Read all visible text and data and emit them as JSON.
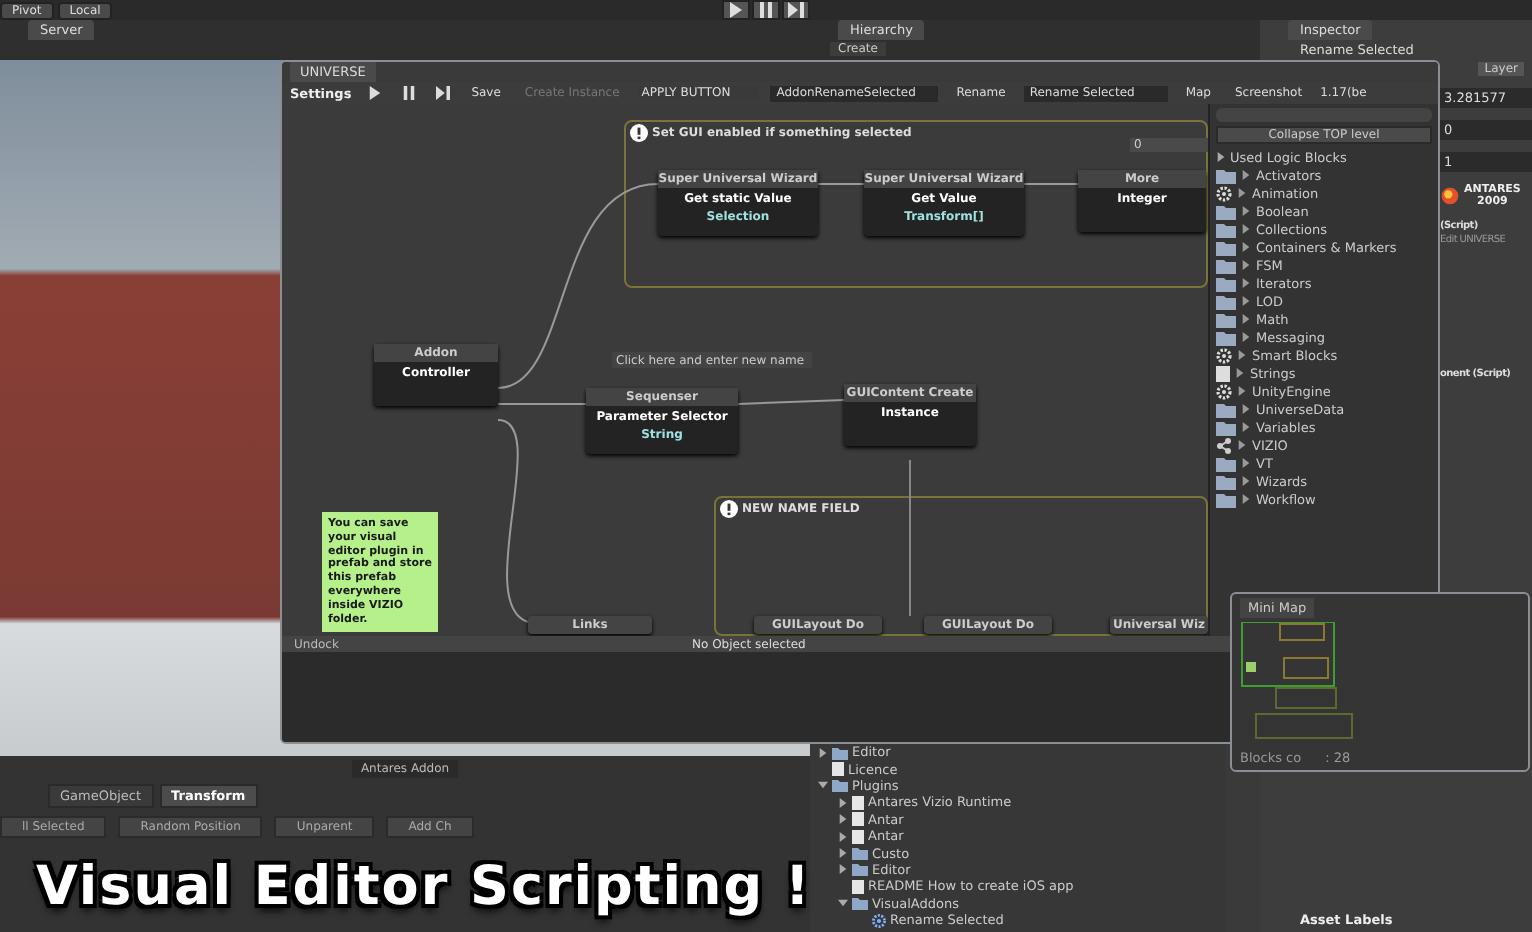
{
  "editor": {
    "pivot": "Pivot",
    "local": "Local"
  },
  "server_panel": {
    "tab": "Server"
  },
  "hierarchy_panel": {
    "tab": "Hierarchy",
    "create": "Create"
  },
  "inspector": {
    "tab": "Inspector",
    "object": "Rename Selected",
    "layer": "Layer",
    "fields": [
      "3.281577",
      "0",
      "1"
    ],
    "logo": {
      "name": "ANTARES",
      "year": "2009"
    },
    "sections": [
      "(Script)",
      "Edit UNIVERSE",
      "onent (Script)"
    ],
    "asset_labels": "Asset Labels"
  },
  "universe": {
    "tab": "UNIVERSE",
    "toolbar": [
      {
        "kind": "label",
        "text": "Settings",
        "disabled": false
      },
      {
        "kind": "play",
        "disabled": false
      },
      {
        "kind": "pause",
        "disabled": false
      },
      {
        "kind": "step",
        "disabled": false
      },
      {
        "kind": "button",
        "text": "Save",
        "disabled": false
      },
      {
        "kind": "button",
        "text": "Create Instance",
        "disabled": true
      },
      {
        "kind": "dropdown",
        "text": "APPLY BUTTON",
        "disabled": false
      },
      {
        "kind": "field",
        "text": "AddonRenameSelected",
        "disabled": false
      },
      {
        "kind": "button",
        "text": "Rename",
        "disabled": false
      },
      {
        "kind": "field",
        "text": "Rename Selected",
        "disabled": false
      },
      {
        "kind": "button",
        "text": "Map",
        "disabled": false
      },
      {
        "kind": "button",
        "text": "Screenshot",
        "disabled": false
      },
      {
        "kind": "version",
        "text": "1.17(be",
        "disabled": false
      }
    ],
    "groups": [
      {
        "title": "Set GUI enabled if something selected"
      },
      {
        "title": "NEW NAME FIELD"
      }
    ],
    "nodes": [
      {
        "title": "Super Universal Wizard",
        "action": "Get static Value",
        "type": "Selection"
      },
      {
        "title": "Super Universal Wizard",
        "action": "Get Value",
        "type": "Transform[]"
      },
      {
        "title": "More",
        "action": "Integer"
      },
      {
        "title": "Addon",
        "action": "Controller"
      },
      {
        "title": "Sequenser",
        "action": "Parameter Selector",
        "type": "String"
      },
      {
        "title": "GUIContent Create",
        "action": "Instance"
      },
      {
        "title": "Links"
      },
      {
        "title": "GUILayout Do"
      },
      {
        "title": "GUILayout Do"
      },
      {
        "title": "Universal Wiz"
      }
    ],
    "value_field": "0",
    "name_field": {
      "placeholder": "Click here and enter new name"
    },
    "note": "You can save your visual editor plugin in prefab and store this prefab everywhere inside VIZIO folder.",
    "library": {
      "collapse": "Collapse TOP level",
      "header": "Used Logic Blocks",
      "items": [
        {
          "label": "Activators",
          "kind": "folder"
        },
        {
          "label": "Animation",
          "kind": "gear"
        },
        {
          "label": "Boolean",
          "kind": "folder"
        },
        {
          "label": "Collections",
          "kind": "folder"
        },
        {
          "label": "Containers & Markers",
          "kind": "folder"
        },
        {
          "label": "FSM",
          "kind": "folder"
        },
        {
          "label": "Iterators",
          "kind": "folder"
        },
        {
          "label": "LOD",
          "kind": "folder"
        },
        {
          "label": "Math",
          "kind": "folder"
        },
        {
          "label": "Messaging",
          "kind": "folder"
        },
        {
          "label": "Smart Blocks",
          "kind": "gear"
        },
        {
          "label": "Strings",
          "kind": "doc"
        },
        {
          "label": "UnityEngine",
          "kind": "gear"
        },
        {
          "label": "UniverseData",
          "kind": "folder"
        },
        {
          "label": "Variables",
          "kind": "folder"
        },
        {
          "label": "VIZIO",
          "kind": "share"
        },
        {
          "label": "VT",
          "kind": "folder"
        },
        {
          "label": "Wizards",
          "kind": "folder"
        },
        {
          "label": "Workflow",
          "kind": "folder"
        }
      ]
    },
    "status": {
      "undock": "Undock",
      "selection": "No Object selected"
    }
  },
  "mini_map": {
    "title": "Mini Map",
    "count_start": "Blocks co",
    "count_end": ": 28"
  },
  "addon_panel": {
    "title": "Antares Addon",
    "tabs": [
      {
        "label": "GameObject",
        "selected": false
      },
      {
        "label": "Transform",
        "selected": true
      }
    ],
    "buttons": [
      "ll Selected",
      "Random Position",
      "Unparent",
      "Add Ch"
    ]
  },
  "project": {
    "items": [
      {
        "label": "Editor",
        "kind": "folder",
        "expanded": false
      },
      {
        "label": "Licence",
        "kind": "doc"
      },
      {
        "label": "Plugins",
        "kind": "folder",
        "expanded": true,
        "children": [
          {
            "label": "Antares Vizio Runtime",
            "kind": "doc",
            "expanded": false
          },
          {
            "label": "Antar",
            "kind": "doc",
            "expanded": false
          },
          {
            "label": "Antar",
            "kind": "doc",
            "expanded": false
          },
          {
            "label": "Custo",
            "kind": "folder",
            "expanded": false
          },
          {
            "label": "Editor",
            "kind": "folder",
            "expanded": false
          },
          {
            "label": "README How to create iOS app",
            "kind": "doc"
          },
          {
            "label": "VisualAddons",
            "kind": "folder",
            "expanded": true,
            "children": [
              {
                "label": "Rename Selected",
                "kind": "gear"
              }
            ]
          }
        ]
      }
    ]
  },
  "caption": "Visual Editor Scripting !"
}
